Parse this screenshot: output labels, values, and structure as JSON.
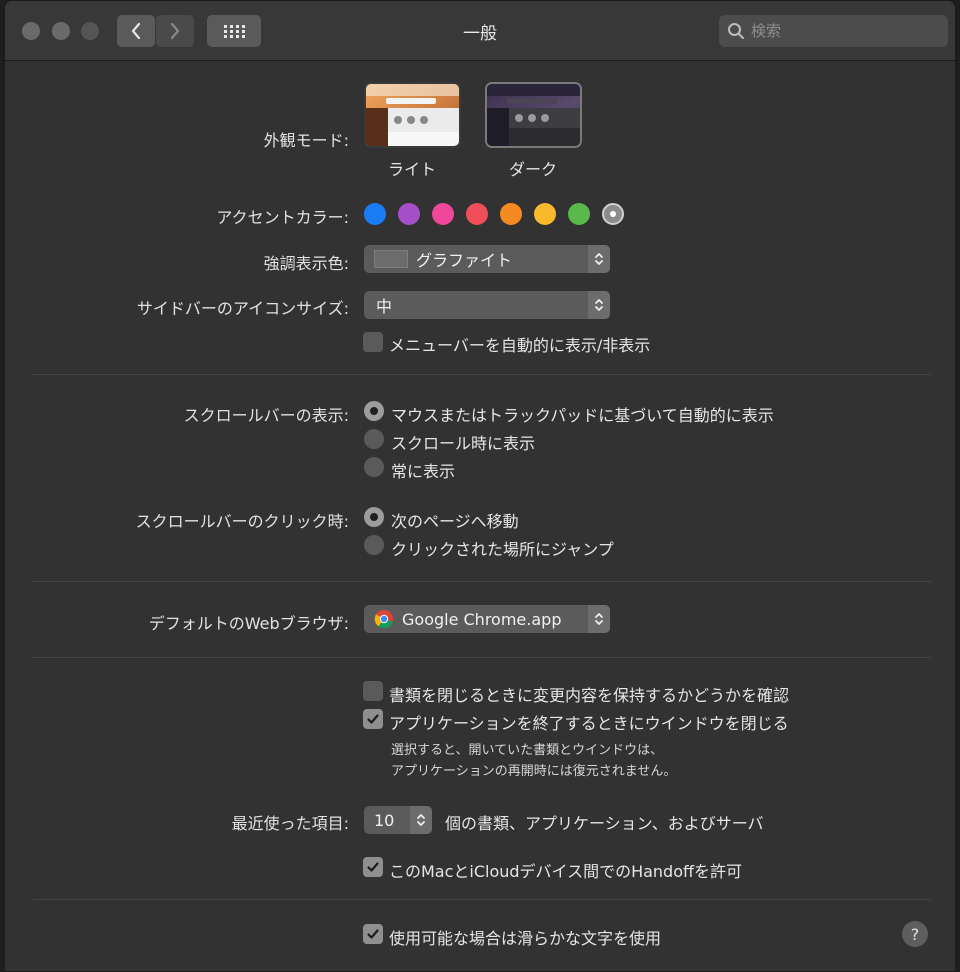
{
  "window": {
    "title": "一般"
  },
  "search": {
    "placeholder": "検索"
  },
  "appearance": {
    "label": "外観モード:",
    "light": "ライト",
    "dark": "ダーク"
  },
  "accent": {
    "label": "アクセントカラー:",
    "colors": [
      "#1a7cf5",
      "#a550c8",
      "#f0479a",
      "#f04e58",
      "#f48a22",
      "#f8b92d",
      "#5bb84a",
      "#8c8c8c"
    ]
  },
  "highlight": {
    "label": "強調表示色:",
    "value": "グラファイト"
  },
  "sidebar_icon": {
    "label": "サイドバーのアイコンサイズ:",
    "value": "中"
  },
  "menubar_autohide": {
    "label": "メニューバーを自動的に表示/非表示",
    "checked": false
  },
  "scrollbar_show": {
    "label": "スクロールバーの表示:",
    "options": [
      "マウスまたはトラックパッドに基づいて自動的に表示",
      "スクロール時に表示",
      "常に表示"
    ],
    "selected": 0
  },
  "scrollbar_click": {
    "label": "スクロールバーのクリック時:",
    "options": [
      "次のページへ移動",
      "クリックされた場所にジャンプ"
    ],
    "selected": 0
  },
  "browser": {
    "label": "デフォルトのWebブラウザ:",
    "value": "Google Chrome.app"
  },
  "ask_keep_changes": {
    "label": "書類を閉じるときに変更内容を保持するかどうかを確認",
    "checked": false
  },
  "close_windows": {
    "label": "アプリケーションを終了するときにウインドウを閉じる",
    "checked": true
  },
  "close_windows_note": {
    "line1": "選択すると、開いていた書類とウインドウは、",
    "line2": "アプリケーションの再開時には復元されません。"
  },
  "recent": {
    "label": "最近使った項目:",
    "value": "10",
    "suffix": "個の書類、アプリケーション、およびサーバ"
  },
  "handoff": {
    "label": "このMacとiCloudデバイス間でのHandoffを許可",
    "checked": true
  },
  "smoothing": {
    "label": "使用可能な場合は滑らかな文字を使用",
    "checked": true
  },
  "help": {
    "label": "?"
  }
}
